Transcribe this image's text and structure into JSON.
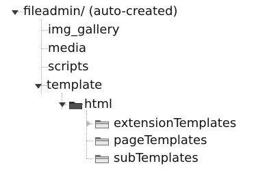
{
  "tree": {
    "root": {
      "label": "fileadmin/ (auto-created)",
      "state": "expanded",
      "children": [
        {
          "label": "img_gallery"
        },
        {
          "label": "media"
        },
        {
          "label": "scripts"
        },
        {
          "label": "template",
          "state": "expanded",
          "children": [
            {
              "label": "html",
              "state": "expanded",
              "icon": "open-folder-icon",
              "children": [
                {
                  "label": "extensionTemplates",
                  "state": "collapsed",
                  "icon": "folder-icon"
                },
                {
                  "label": "pageTemplates",
                  "icon": "folder-icon"
                },
                {
                  "label": "subTemplates",
                  "icon": "folder-icon"
                }
              ]
            }
          ]
        }
      ]
    }
  },
  "colors": {
    "guide_line": "#a8a8a8",
    "expanded_toggle": "#3a3a3a",
    "collapsed_toggle": "#b8b8b8",
    "folder_fill": "#6f6f6f",
    "folder_dark": "#4a4a4a",
    "open_folder_fill": "#2f2f2f"
  }
}
